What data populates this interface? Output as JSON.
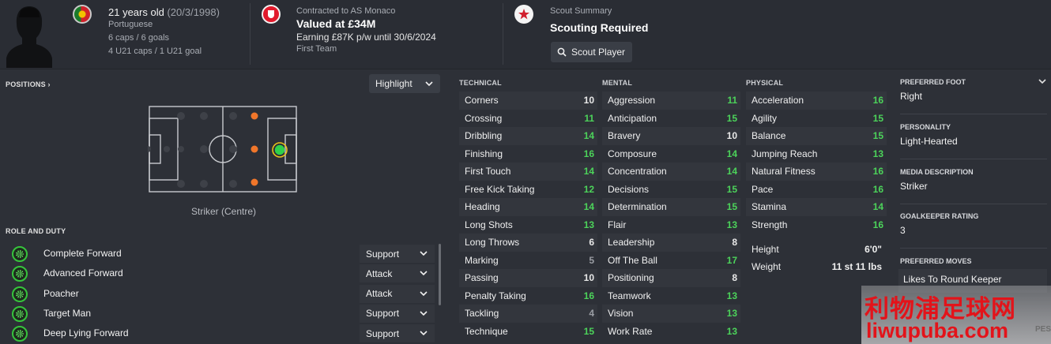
{
  "header": {
    "age_text": "21 years old",
    "dob_text": "(20/3/1998)",
    "nationality": "Portuguese",
    "caps": "6 caps / 6 goals",
    "u21_caps": "4 U21 caps / 1 U21 goal",
    "contract_label": "Contracted to AS Monaco",
    "value": "Valued at £34M",
    "wage": "Earning £87K p/w until 30/6/2024",
    "squad_status": "First Team",
    "scout_label": "Scout Summary",
    "scout_status": "Scouting Required",
    "scout_button": "Scout Player"
  },
  "positions": {
    "title": "POSITIONS",
    "highlight_label": "Highlight",
    "caption": "Striker (Centre)"
  },
  "roles": {
    "title": "ROLE AND DUTY",
    "items": [
      {
        "name": "Complete Forward",
        "duty": "Support"
      },
      {
        "name": "Advanced Forward",
        "duty": "Attack"
      },
      {
        "name": "Poacher",
        "duty": "Attack"
      },
      {
        "name": "Target Man",
        "duty": "Support"
      },
      {
        "name": "Deep Lying Forward",
        "duty": "Support"
      }
    ]
  },
  "attributes": {
    "technical_title": "TECHNICAL",
    "mental_title": "MENTAL",
    "physical_title": "PHYSICAL",
    "technical": [
      {
        "name": "Corners",
        "value": "10"
      },
      {
        "name": "Crossing",
        "value": "11"
      },
      {
        "name": "Dribbling",
        "value": "14"
      },
      {
        "name": "Finishing",
        "value": "16"
      },
      {
        "name": "First Touch",
        "value": "14"
      },
      {
        "name": "Free Kick Taking",
        "value": "12"
      },
      {
        "name": "Heading",
        "value": "14"
      },
      {
        "name": "Long Shots",
        "value": "13"
      },
      {
        "name": "Long Throws",
        "value": "6"
      },
      {
        "name": "Marking",
        "value": "5"
      },
      {
        "name": "Passing",
        "value": "10"
      },
      {
        "name": "Penalty Taking",
        "value": "16"
      },
      {
        "name": "Tackling",
        "value": "4"
      },
      {
        "name": "Technique",
        "value": "15"
      }
    ],
    "mental": [
      {
        "name": "Aggression",
        "value": "11"
      },
      {
        "name": "Anticipation",
        "value": "15"
      },
      {
        "name": "Bravery",
        "value": "10"
      },
      {
        "name": "Composure",
        "value": "14"
      },
      {
        "name": "Concentration",
        "value": "14"
      },
      {
        "name": "Decisions",
        "value": "15"
      },
      {
        "name": "Determination",
        "value": "15"
      },
      {
        "name": "Flair",
        "value": "13"
      },
      {
        "name": "Leadership",
        "value": "8"
      },
      {
        "name": "Off The Ball",
        "value": "17"
      },
      {
        "name": "Positioning",
        "value": "8"
      },
      {
        "name": "Teamwork",
        "value": "13"
      },
      {
        "name": "Vision",
        "value": "13"
      },
      {
        "name": "Work Rate",
        "value": "13"
      }
    ],
    "physical": [
      {
        "name": "Acceleration",
        "value": "16"
      },
      {
        "name": "Agility",
        "value": "15"
      },
      {
        "name": "Balance",
        "value": "15"
      },
      {
        "name": "Jumping Reach",
        "value": "13"
      },
      {
        "name": "Natural Fitness",
        "value": "16"
      },
      {
        "name": "Pace",
        "value": "16"
      },
      {
        "name": "Stamina",
        "value": "14"
      },
      {
        "name": "Strength",
        "value": "16"
      }
    ],
    "height_label": "Height",
    "height_value": "6'0\"",
    "weight_label": "Weight",
    "weight_value": "11 st 11 lbs"
  },
  "info": {
    "foot_label": "PREFERRED FOOT",
    "foot_value": "Right",
    "personality_label": "PERSONALITY",
    "personality_value": "Light-Hearted",
    "media_label": "MEDIA DESCRIPTION",
    "media_value": "Striker",
    "gk_label": "GOALKEEPER RATING",
    "gk_value": "3",
    "moves_label": "PREFERRED MOVES",
    "moves_value": "Likes To Round Keeper"
  },
  "watermark": {
    "chinese": "利物浦足球网",
    "url": "liwupuba.com",
    "side": "PES"
  },
  "colors": {
    "background": "#2d3037",
    "value_green": "#4cd35a",
    "value_white": "#e8e8e8",
    "value_grey": "#9a9da3",
    "accent_red": "#e11a2c"
  }
}
